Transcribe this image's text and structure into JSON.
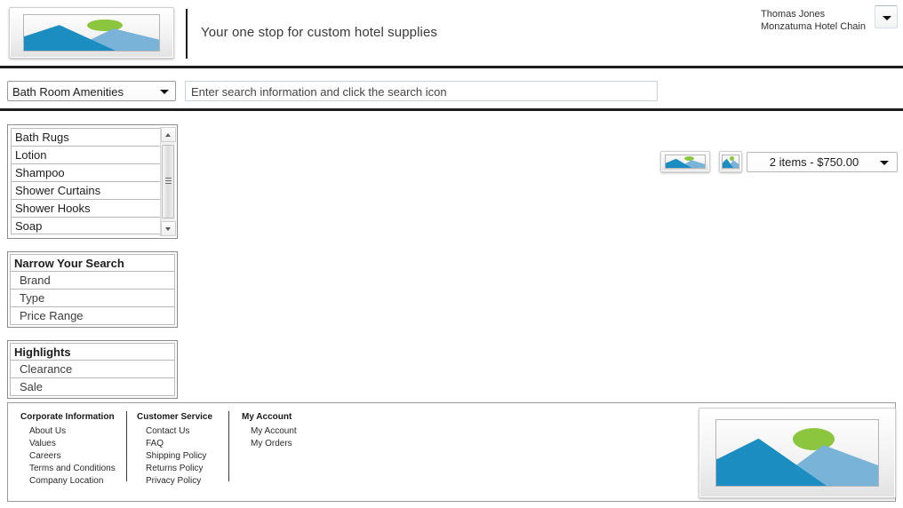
{
  "header": {
    "logo_icon": "image-placeholder-icon",
    "tagline": "Your one stop for custom hotel supplies",
    "user": {
      "name": "Thomas Jones",
      "company": "Monzatuma Hotel Chain"
    },
    "user_menu_icon": "chevron-down-icon"
  },
  "search": {
    "category_selected": "Bath Room Amenities",
    "category_caret_icon": "chevron-down-icon",
    "placeholder": "Enter search information and click the search icon",
    "value": "",
    "search_icon": "image-placeholder-icon",
    "cart_icon": "image-placeholder-icon",
    "cart_summary": "2 items - $750.00",
    "cart_caret_icon": "chevron-down-icon"
  },
  "sidebar": {
    "categories": [
      "Bath Rugs",
      "Lotion",
      "Shampoo",
      "Shower Curtains",
      "Shower Hooks",
      "Soap"
    ],
    "scroll_up_icon": "triangle-up-icon",
    "scroll_down_icon": "triangle-down-icon",
    "panels": [
      {
        "title": "Narrow Your Search",
        "items": [
          "Brand",
          "Type",
          "Price Range"
        ]
      },
      {
        "title": "Highlights",
        "items": [
          "Clearance",
          "Sale"
        ]
      }
    ]
  },
  "footer": {
    "columns": [
      {
        "heading": "Corporate Information",
        "links": [
          "About Us",
          "Values",
          "Careers",
          "Terms and Conditions",
          "Company Location"
        ]
      },
      {
        "heading": "Customer Service",
        "links": [
          "Contact Us",
          "FAQ",
          "Shipping Policy",
          "Returns Policy",
          "Privacy Policy"
        ]
      },
      {
        "heading": "My Account",
        "links": [
          "My Account",
          "My Orders"
        ]
      }
    ],
    "logo_icon": "image-placeholder-icon"
  },
  "colors": {
    "mountain_front": "#1b8dc0",
    "mountain_back": "#7ab3d8",
    "sun": "#8cc63f",
    "rule": "#1c1c1c"
  }
}
